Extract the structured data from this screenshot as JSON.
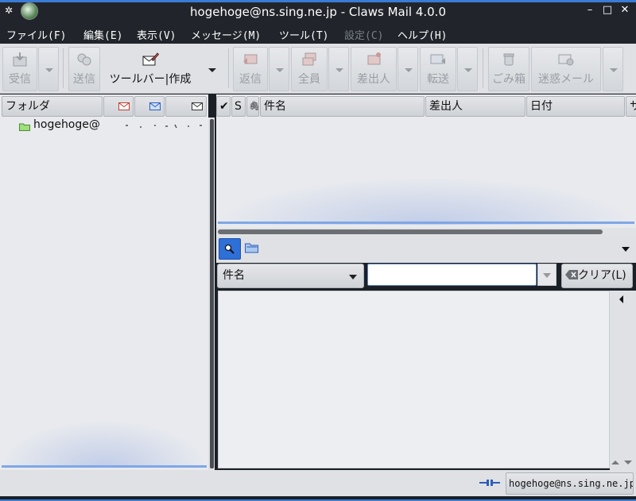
{
  "window": {
    "title": "hogehoge@ns.sing.ne.jp - Claws Mail 4.0.0",
    "controls": {
      "minimize": "–",
      "maximize": "□",
      "close": "✕"
    }
  },
  "menubar": [
    {
      "label": "ファイル(F)",
      "enabled": true
    },
    {
      "label": "編集(E)",
      "enabled": true
    },
    {
      "label": "表示(V)",
      "enabled": true
    },
    {
      "label": "メッセージ(M)",
      "enabled": true
    },
    {
      "label": "ツール(T)",
      "enabled": true
    },
    {
      "label": "設定(C)",
      "enabled": false
    },
    {
      "label": "ヘルプ(H)",
      "enabled": true
    }
  ],
  "toolbar": {
    "receive": {
      "label": "受信",
      "icon": "receive-mail-icon"
    },
    "send": {
      "label": "送信",
      "icon": "send-mail-icon"
    },
    "compose": {
      "label": "ツールバー|作成",
      "icon": "compose-icon"
    },
    "reply": {
      "label": "返信",
      "icon": "reply-icon"
    },
    "reply_all": {
      "label": "全員",
      "icon": "reply-all-icon"
    },
    "reply_sender": {
      "label": "差出人",
      "icon": "reply-sender-icon"
    },
    "forward": {
      "label": "転送",
      "icon": "forward-icon"
    },
    "trash": {
      "label": "ごみ箱",
      "icon": "trash-icon"
    },
    "spam": {
      "label": "迷惑メール",
      "icon": "spam-icon"
    }
  },
  "folder_pane": {
    "header": {
      "folder": "フォルダ",
      "new_icon": "new-mail-icon",
      "unread_icon": "unread-mail-icon",
      "total_icon": "total-mail-icon"
    },
    "items": [
      {
        "name": "hogehoge@",
        "icon": "folder-icon"
      }
    ]
  },
  "message_list": {
    "columns": {
      "mark": "✔",
      "status": "S",
      "attach": "🖇",
      "subject": "件名",
      "from": "差出人",
      "date": "日付",
      "size": "サ"
    }
  },
  "quicksearch": {
    "field": "件名",
    "value": "",
    "clear_label": "クリア(L)"
  },
  "statusbar": {
    "account": "hogehoge@ns.sing.ne.jp",
    "icon": "online-icon"
  }
}
